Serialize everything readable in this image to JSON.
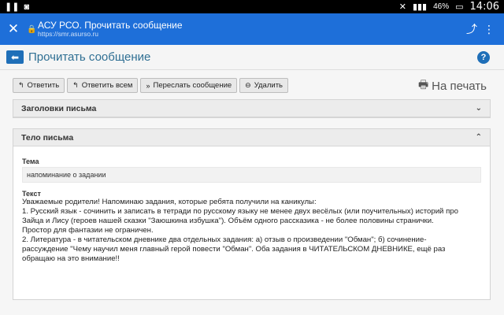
{
  "statusbar": {
    "time": "14:06",
    "battery": "46%"
  },
  "browser": {
    "title": "АСУ РСО. Прочитать сообщение",
    "url": "https://smr.asurso.ru"
  },
  "page": {
    "title": "Прочитать сообщение",
    "help": "?"
  },
  "toolbar": {
    "reply": "Ответить",
    "reply_all": "Ответить всем",
    "forward": "Переслать сообщение",
    "delete": "Удалить",
    "print": "На печать"
  },
  "headers_panel": {
    "title": "Заголовки письма"
  },
  "body_panel": {
    "title": "Тело письма",
    "subject_label": "Тема",
    "subject": "напоминание о задании",
    "text_label": "Текст",
    "lines": [
      "Уважаемые родители! Напоминаю задания, которые ребята получили на каникулы:",
      "1. Русский язык - сочинить и записать в тетради по русскому языку не менее двух весёлых (или поучительных) историй про",
      "Зайца и Лису (героев нашей сказки \"Заюшкина избушка\"). Объём одного рассказика - не более половины странички.",
      "Простор для фантазии не ограничен.",
      "2. Литература - в читательском дневнике два отдельных задания: а) отзыв о произведении \"Обман\"; б) сочинение-",
      "рассуждение \"Чему научил меня  главный герой повести  \"Обман\". Оба задания в ЧИТАТЕЛЬСКОМ ДНЕВНИКЕ, ещё раз",
      "обращаю на это внимание!!"
    ]
  }
}
